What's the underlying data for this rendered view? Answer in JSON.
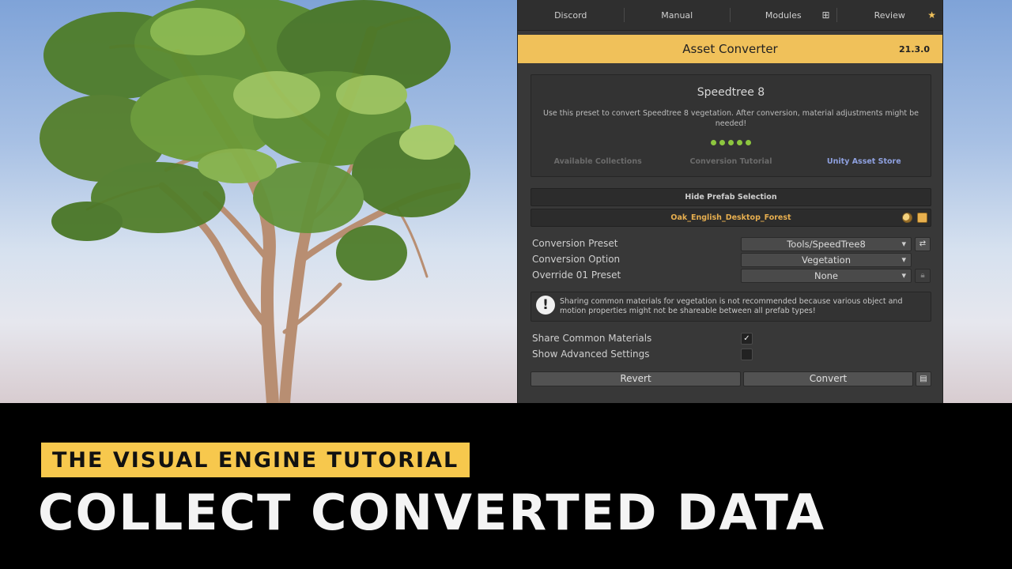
{
  "nav": {
    "discord": "Discord",
    "manual": "Manual",
    "modules": "Modules",
    "review": "Review"
  },
  "header": {
    "title": "Asset Converter",
    "version": "21.3.0"
  },
  "preset_card": {
    "title": "Speedtree 8",
    "description": "Use this preset to convert Speedtree 8 vegetation. After conversion, material adjustments might be needed!",
    "rating_dots": 5,
    "links": [
      "Available Collections",
      "Conversion Tutorial",
      "Unity Asset Store"
    ]
  },
  "prefab": {
    "toggle_label": "Hide Prefab Selection",
    "name": "Oak_English_Desktop_Forest"
  },
  "settings": {
    "conversion_preset": {
      "label": "Conversion Preset",
      "value": "Tools/SpeedTree8"
    },
    "conversion_option": {
      "label": "Conversion Option",
      "value": "Vegetation"
    },
    "override_preset": {
      "label": "Override 01 Preset",
      "value": "None"
    }
  },
  "warning": "Sharing common materials for vegetation is not recommended because various object and motion properties might not be shareable between all prefab types!",
  "checks": {
    "share_common": {
      "label": "Share Common Materials",
      "checked": true,
      "mark": "✓"
    },
    "show_advanced": {
      "label": "Show Advanced Settings",
      "checked": false
    }
  },
  "actions": {
    "revert": "Revert",
    "convert": "Convert"
  },
  "overlay": {
    "tag": "THE VISUAL ENGINE TUTORIAL",
    "headline": "COLLECT CONVERTED DATA"
  },
  "colors": {
    "accent": "#f0c15a",
    "tag": "#f7c84d",
    "dot": "#8dc63f",
    "link_active": "#8fa1e0",
    "prefab_text": "#e6ae4f"
  }
}
